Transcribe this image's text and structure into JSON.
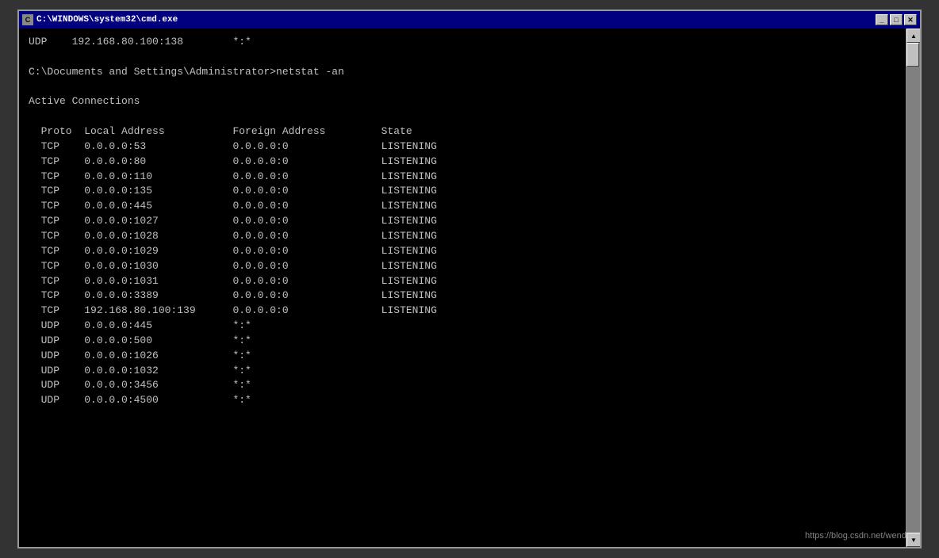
{
  "window": {
    "title": "C:\\WINDOWS\\system32\\cmd.exe",
    "minimize_label": "_",
    "maximize_label": "□",
    "close_label": "✕"
  },
  "terminal": {
    "prev_line": "UDP    192.168.80.100:138        *:*",
    "command_line": "C:\\Documents and Settings\\Administrator>netstat -an",
    "section_header": "Active Connections",
    "col_headers": "  Proto  Local Address           Foreign Address         State",
    "rows": [
      "  TCP    0.0.0.0:53              0.0.0.0:0               LISTENING",
      "  TCP    0.0.0.0:80              0.0.0.0:0               LISTENING",
      "  TCP    0.0.0.0:110             0.0.0.0:0               LISTENING",
      "  TCP    0.0.0.0:135             0.0.0.0:0               LISTENING",
      "  TCP    0.0.0.0:445             0.0.0.0:0               LISTENING",
      "  TCP    0.0.0.0:1027            0.0.0.0:0               LISTENING",
      "  TCP    0.0.0.0:1028            0.0.0.0:0               LISTENING",
      "  TCP    0.0.0.0:1029            0.0.0.0:0               LISTENING",
      "  TCP    0.0.0.0:1030            0.0.0.0:0               LISTENING",
      "  TCP    0.0.0.0:1031            0.0.0.0:0               LISTENING",
      "  TCP    0.0.0.0:3389            0.0.0.0:0               LISTENING",
      "  TCP    192.168.80.100:139      0.0.0.0:0               LISTENING",
      "  UDP    0.0.0.0:445             *:*",
      "  UDP    0.0.0.0:500             *:*",
      "  UDP    0.0.0.0:1026            *:*",
      "  UDP    0.0.0.0:1032            *:*",
      "  UDP    0.0.0.0:3456            *:*",
      "  UDP    0.0.0.0:4500            *:*"
    ],
    "watermark": "https://blog.csdn.net/wend..."
  }
}
